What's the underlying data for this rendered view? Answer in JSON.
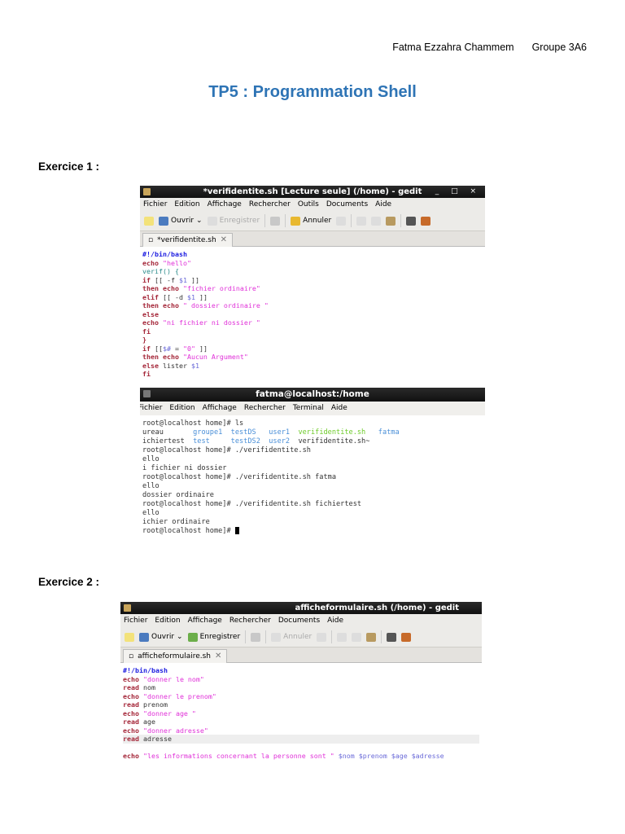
{
  "header": {
    "author": "Fatma Ezzahra Chammem",
    "group": "Groupe 3A6"
  },
  "title": "TP5 : Programmation Shell",
  "ex1": {
    "label": "Exercice 1 :",
    "editor": {
      "window_title": "*verifidentite.sh [Lecture seule] (/home) - gedit",
      "window_controls": "_ □ ×",
      "menu": [
        "Fichier",
        "Edition",
        "Affichage",
        "Rechercher",
        "Outils",
        "Documents",
        "Aide"
      ],
      "toolbar": {
        "open": "Ouvrir",
        "save": "Enregistrer",
        "undo": "Annuler"
      },
      "tab": "*verifidentite.sh",
      "lines": [
        [
          {
            "t": "#!/bin/bash",
            "c": "sh"
          }
        ],
        [
          {
            "t": "echo ",
            "c": "kw"
          },
          {
            "t": "\"hello\"",
            "c": "str"
          }
        ],
        [
          {
            "t": "verif() {",
            "c": "fn"
          }
        ],
        [
          {
            "t": "if",
            "c": "kw"
          },
          {
            "t": " [[ -f ",
            "c": "pl"
          },
          {
            "t": "$1",
            "c": "var"
          },
          {
            "t": " ]]",
            "c": "pl"
          }
        ],
        [
          {
            "t": "then echo ",
            "c": "kw"
          },
          {
            "t": "\"fichier ordinaire\"",
            "c": "str"
          }
        ],
        [
          {
            "t": "elif",
            "c": "kw"
          },
          {
            "t": " [[ -d ",
            "c": "pl"
          },
          {
            "t": "$1",
            "c": "var"
          },
          {
            "t": " ]]",
            "c": "pl"
          }
        ],
        [
          {
            "t": "then echo ",
            "c": "kw"
          },
          {
            "t": "\" dossier ordinaire \"",
            "c": "str"
          }
        ],
        [
          {
            "t": "else",
            "c": "kw"
          }
        ],
        [
          {
            "t": "echo ",
            "c": "kw"
          },
          {
            "t": "\"ni fichier ni dossier \"",
            "c": "str"
          }
        ],
        [
          {
            "t": "fi",
            "c": "kw"
          }
        ],
        [
          {
            "t": "}",
            "c": "kw"
          }
        ],
        [
          {
            "t": "if",
            "c": "kw"
          },
          {
            "t": " [[",
            "c": "pl"
          },
          {
            "t": "$#",
            "c": "var"
          },
          {
            "t": " = ",
            "c": "pl"
          },
          {
            "t": "\"0\"",
            "c": "str"
          },
          {
            "t": " ]]",
            "c": "pl"
          }
        ],
        [
          {
            "t": "then echo ",
            "c": "kw"
          },
          {
            "t": "\"Aucun Argument\"",
            "c": "str"
          }
        ],
        [
          {
            "t": "else",
            "c": "kw"
          },
          {
            "t": " lister ",
            "c": "pl"
          },
          {
            "t": "$1",
            "c": "var"
          }
        ],
        [
          {
            "t": "fi",
            "c": "kw"
          }
        ]
      ]
    },
    "terminal": {
      "window_title": "fatma@localhost:/home",
      "menu": [
        "Fichier",
        "Edition",
        "Affichage",
        "Rechercher",
        "Terminal",
        "Aide"
      ],
      "lines": [
        [
          {
            "t": "root@localhost home]# ls",
            "c": "pl"
          }
        ],
        [
          {
            "t": "ureau       ",
            "c": "pl"
          },
          {
            "t": "groupe1  testDS   user1  ",
            "c": "dir"
          },
          {
            "t": "verifidentite.sh",
            "c": "exe"
          },
          {
            "t": "   fatma",
            "c": "dir"
          }
        ],
        [
          {
            "t": "ichiertest  ",
            "c": "pl"
          },
          {
            "t": "test     testDS2  user2  ",
            "c": "dir"
          },
          {
            "t": "verifidentite.sh~",
            "c": "pl"
          }
        ],
        [
          {
            "t": "root@localhost home]# ./verifidentite.sh",
            "c": "pl"
          }
        ],
        [
          {
            "t": "ello",
            "c": "pl"
          }
        ],
        [
          {
            "t": "i fichier ni dossier",
            "c": "pl"
          }
        ],
        [
          {
            "t": "root@localhost home]# ./verifidentite.sh fatma",
            "c": "pl"
          }
        ],
        [
          {
            "t": "ello",
            "c": "pl"
          }
        ],
        [
          {
            "t": "dossier ordinaire",
            "c": "pl"
          }
        ],
        [
          {
            "t": "root@localhost home]# ./verifidentite.sh fichiertest",
            "c": "pl"
          }
        ],
        [
          {
            "t": "ello",
            "c": "pl"
          }
        ],
        [
          {
            "t": "ichier ordinaire",
            "c": "pl"
          }
        ],
        [
          {
            "t": "root@localhost home]# ",
            "c": "pl"
          }
        ]
      ]
    }
  },
  "ex2": {
    "label": "Exercice 2 :",
    "editor": {
      "window_title": "afficheformulaire.sh (/home) - gedit",
      "menu": [
        "Fichier",
        "Edition",
        "Affichage",
        "Rechercher",
        "Documents",
        "Aide"
      ],
      "toolbar": {
        "open": "Ouvrir",
        "save": "Enregistrer",
        "undo": "Annuler"
      },
      "tab": "afficheformulaire.sh",
      "lines": [
        [
          {
            "t": "#!/bin/bash",
            "c": "sh"
          }
        ],
        [
          {
            "t": "echo ",
            "c": "kw"
          },
          {
            "t": "\"donner le nom\"",
            "c": "str"
          }
        ],
        [
          {
            "t": "read ",
            "c": "kw"
          },
          {
            "t": "nom",
            "c": "pl"
          }
        ],
        [
          {
            "t": "echo ",
            "c": "kw"
          },
          {
            "t": "\"donner le prenom\"",
            "c": "str"
          }
        ],
        [
          {
            "t": "read ",
            "c": "kw"
          },
          {
            "t": "prenom",
            "c": "pl"
          }
        ],
        [
          {
            "t": "echo ",
            "c": "kw"
          },
          {
            "t": "\"donner age \"",
            "c": "str"
          }
        ],
        [
          {
            "t": "read ",
            "c": "kw"
          },
          {
            "t": "age",
            "c": "pl"
          }
        ],
        [
          {
            "t": "echo ",
            "c": "kw"
          },
          {
            "t": "\"donner adresse\"",
            "c": "str"
          }
        ],
        [
          {
            "t": "read ",
            "c": "kw"
          },
          {
            "t": "adresse",
            "c": "pl"
          }
        ],
        [],
        [
          {
            "t": "echo ",
            "c": "kw"
          },
          {
            "t": "\"les informations concernant la personne sont \" ",
            "c": "str"
          },
          {
            "t": "$nom $prenom $age $adresse",
            "c": "var"
          }
        ]
      ]
    }
  }
}
